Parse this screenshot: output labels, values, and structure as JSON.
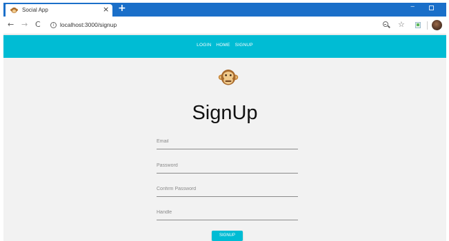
{
  "browser": {
    "tab": {
      "title": "Social App",
      "favicon": "monkey-icon"
    },
    "new_tab_icon": "+",
    "url": "localhost:3000/signup",
    "icons": [
      "back-arrow-icon",
      "forward-arrow-icon",
      "reload-icon",
      "info-icon",
      "zoom-icon",
      "star-icon",
      "extension-icon",
      "profile-avatar"
    ]
  },
  "appbar": {
    "color": "#00bcd4",
    "links": [
      {
        "label": "LOGIN"
      },
      {
        "label": "HOME"
      },
      {
        "label": "SIGNUP"
      }
    ]
  },
  "page": {
    "logo": "monkey-icon",
    "title": "SignUp",
    "fields": {
      "email_placeholder": "Email",
      "password_placeholder": "Password",
      "confirm_placeholder": "Confirm Password",
      "handle_placeholder": "Handle"
    },
    "submit_label": "SIGNUP"
  },
  "colors": {
    "tab_strip": "#1a6fc9",
    "accent": "#00bcd4",
    "page_background": "#f2f2f2"
  }
}
